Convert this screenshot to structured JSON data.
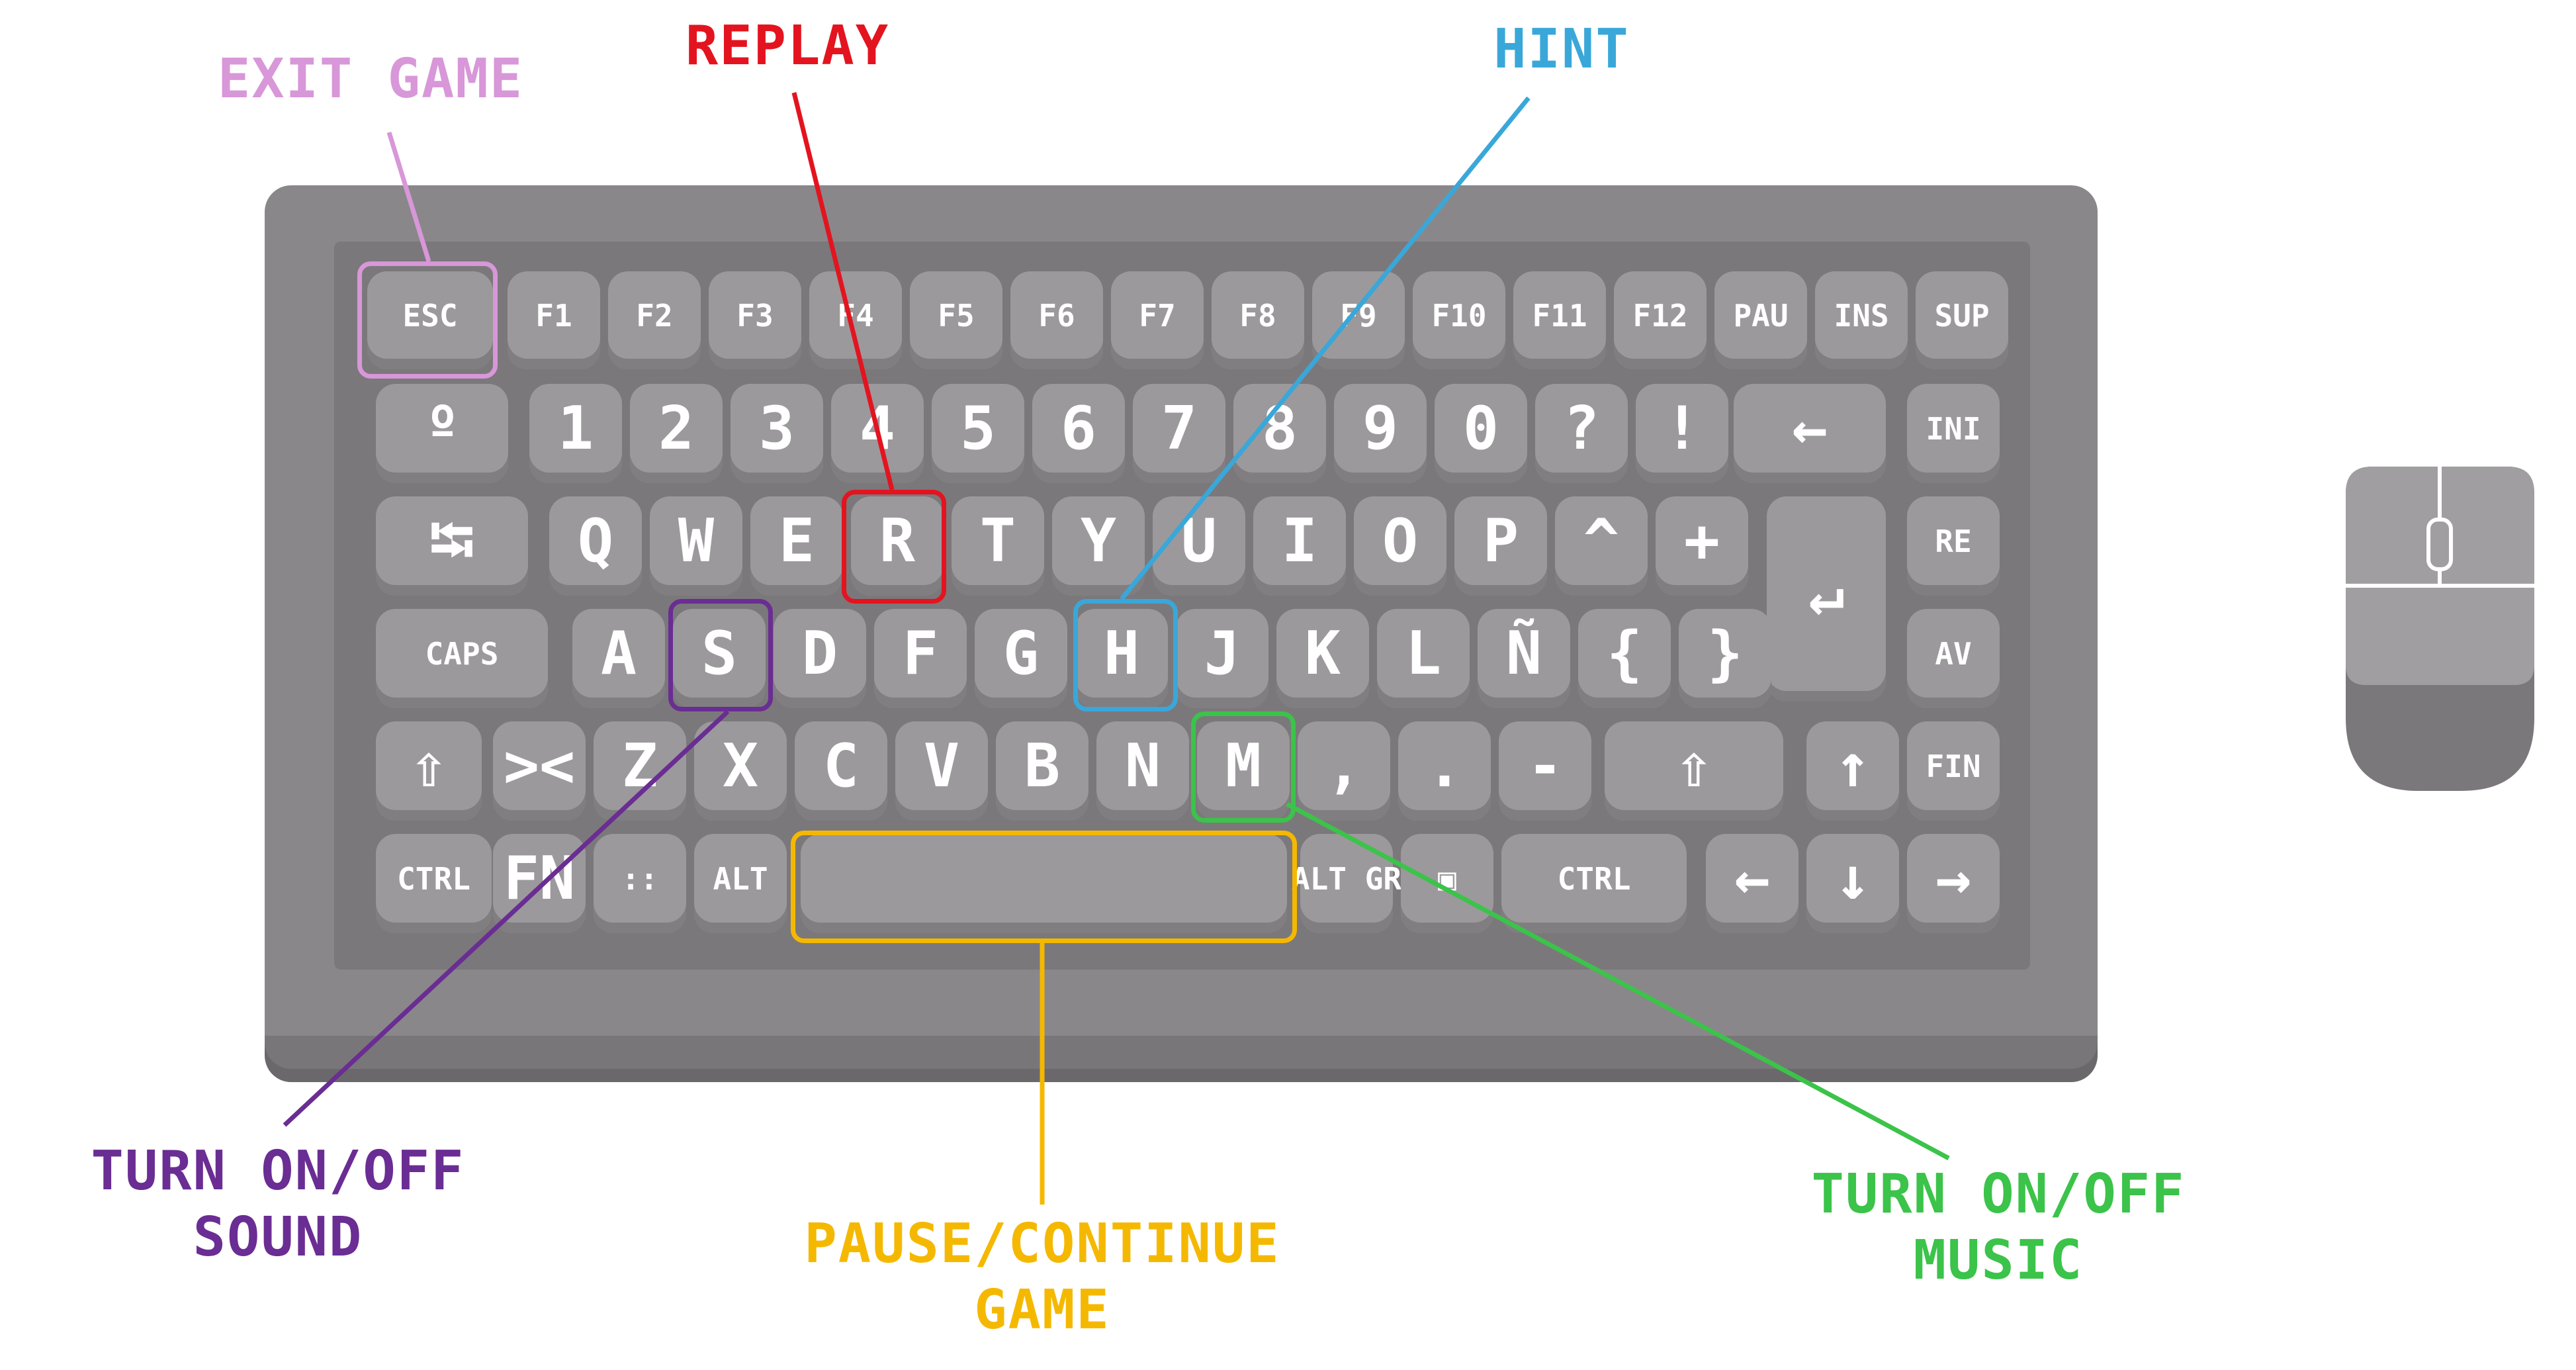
{
  "keyboard": {
    "row_fn": [
      "ESC",
      "F1",
      "F2",
      "F3",
      "F4",
      "F5",
      "F6",
      "F7",
      "F8",
      "F9",
      "F10",
      "F11",
      "F12",
      "PAU",
      "INS",
      "SUP"
    ],
    "row_num": [
      "º",
      "1",
      "2",
      "3",
      "4",
      "5",
      "6",
      "7",
      "8",
      "9",
      "0",
      "?",
      "!",
      "←",
      "INI"
    ],
    "row_q": [
      "⭾",
      "Q",
      "W",
      "E",
      "R",
      "T",
      "Y",
      "U",
      "I",
      "O",
      "P",
      "^",
      "+",
      "↵",
      "RE"
    ],
    "row_a": [
      "CAPS",
      "A",
      "S",
      "D",
      "F",
      "G",
      "H",
      "J",
      "K",
      "L",
      "Ñ",
      "{",
      "}",
      "AV"
    ],
    "row_z": [
      "⇧",
      "><",
      "Z",
      "X",
      "C",
      "V",
      "B",
      "N",
      "M",
      ",",
      ".",
      "-",
      "⇧",
      "↑",
      "FIN"
    ],
    "row_ctrl": [
      "CTRL",
      "FN",
      "::",
      "ALT",
      "",
      "ALT GR",
      "▣",
      "CTRL",
      "←",
      "↓",
      "→"
    ]
  },
  "callouts": {
    "exit": {
      "label": "EXIT GAME",
      "color": "#d897d8"
    },
    "replay": {
      "label": "REPLAY",
      "color": "#e3141f"
    },
    "hint": {
      "label": "HINT",
      "color": "#3aa7d9"
    },
    "sound": {
      "line1": "TURN ON/OFF",
      "line2": "SOUND",
      "color": "#6a2d93"
    },
    "pause": {
      "line1": "PAUSE/CONTINUE",
      "line2": "GAME",
      "color": "#f5b800"
    },
    "music": {
      "line1": "TURN ON/OFF",
      "line2": "MUSIC",
      "color": "#3bc34a"
    }
  }
}
